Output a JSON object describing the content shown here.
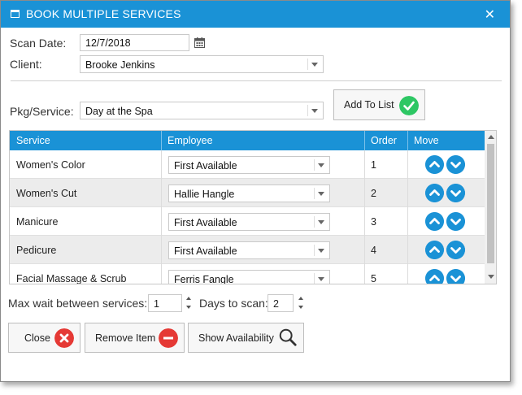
{
  "dialog": {
    "title": "BOOK MULTIPLE SERVICES"
  },
  "form": {
    "scan_date_label": "Scan Date:",
    "scan_date_value": "12/7/2018",
    "client_label": "Client:",
    "client_value": "Brooke Jenkins",
    "pkg_label": "Pkg/Service:",
    "pkg_value": "Day at the Spa",
    "add_to_list_label": "Add To List"
  },
  "grid": {
    "columns": [
      "Service",
      "Employee",
      "Order",
      "Move"
    ],
    "rows": [
      {
        "service": "Women's Color",
        "employee": "First Available",
        "order": "1"
      },
      {
        "service": "Women's Cut",
        "employee": "Hallie Hangle",
        "order": "2"
      },
      {
        "service": "Manicure",
        "employee": "First Available",
        "order": "3"
      },
      {
        "service": "Pedicure",
        "employee": "First Available",
        "order": "4"
      },
      {
        "service": "Facial Massage & Scrub",
        "employee": "Ferris Fangle",
        "order": "5"
      }
    ]
  },
  "options": {
    "max_wait_label": "Max wait between services:",
    "max_wait_value": "1",
    "days_to_scan_label": "Days to scan:",
    "days_to_scan_value": "2"
  },
  "buttons": {
    "close": "Close",
    "remove_item": "Remove Item",
    "show_availability": "Show Availability"
  },
  "colors": {
    "accent": "#1a92d6",
    "success": "#2ec764",
    "danger": "#e53935"
  }
}
